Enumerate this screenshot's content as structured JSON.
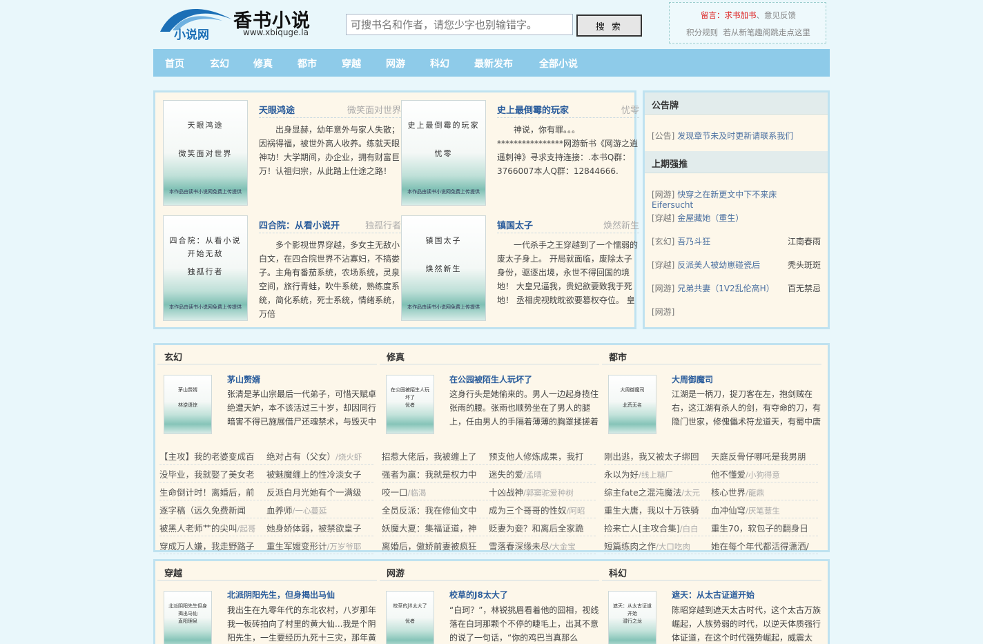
{
  "header": {
    "logo_cn": "小说网",
    "logo_title": "香书小说",
    "logo_url": "www.xbiquge.la",
    "search_placeholder": "可搜书名和作者，请您少字也别输错字。",
    "search_button": "搜 索",
    "notice_prefix": "留言：",
    "notice_link1": "求书加书",
    "notice_sep": "、",
    "notice_link2": "意见反馈",
    "notice_row2a": "积分规则",
    "notice_row2b": "若从新笔趣阁跳走点这里"
  },
  "nav": [
    "首页",
    "玄幻",
    "修真",
    "都市",
    "穿越",
    "网游",
    "科幻",
    "最新发布",
    "全部小说"
  ],
  "featured": [
    {
      "title": "天眼鸿途",
      "author": "微笑面对世界",
      "cover_title": "天眼鸿途",
      "cover_author": "微笑面对世界",
      "desc": "出身显赫，幼年意外与家人失散；因祸得福，被世外高人收养。练就天眼神功！大学期间，办企业，拥有财富巨万！认祖归宗，从此踏上仕途之路！"
    },
    {
      "title": "史上最倒霉的玩家",
      "author": "忧零",
      "cover_title": "史上最倒霉的玩家",
      "cover_author": "忧零",
      "desc": "神说，你有罪。。。****************网游新书《网游之逍遥刺神》寻求支持连接：.本书Q群：3766007本人Q群：12844666."
    },
    {
      "title": "四合院：从看小说开",
      "author": "独孤行者",
      "cover_title": "四合院：从看小说开始无敌",
      "cover_author": "独孤行者",
      "desc": "多个影视世界穿越，多女主无敌小白文，在四合院世界不沾寡妇，不搞娄子。主角有番茄系统，农场系统，灵泉空间，旅行青蛙，吹牛系统，熟练度系统，简化系统，死士系统，情绪系统，万倍"
    },
    {
      "title": "镇国太子",
      "author": "焕然新生",
      "cover_title": "镇国太子",
      "cover_author": "焕然新生",
      "desc": "一代杀手之王穿越到了一个懦弱的废太子身上。 开局就面临，废除太子身份，驱逐出境，永世不得回国的境地！ 大皇兄逼我，贵妃欲要致我于死地！ 丞相虎视眈眈欲要篡权夺位。 皇"
    }
  ],
  "cover_footer": "本作品由读书小说网免费上传提供",
  "sidebar": {
    "board_title": "公告牌",
    "board_items": [
      {
        "cat": "[公告]",
        "text": "发现章节未及时更新请联系我们"
      }
    ],
    "strong_title": "上期强推",
    "strong_items": [
      {
        "cat": "[网游]",
        "title": "快穿之在新更文中下不来床 Eifersucht",
        "author": ""
      },
      {
        "cat": "[穿越]",
        "title": "金屋藏她（重生）",
        "author": ""
      },
      {
        "cat": "[玄幻]",
        "title": "吾乃斗狂",
        "author": "江南春雨"
      },
      {
        "cat": "[穿越]",
        "title": "反派美人被幼崽碰瓷后",
        "author": "秃头斑斑"
      },
      {
        "cat": "[网游]",
        "title": "兄弟共妻（1V2乱伦高H）",
        "author": "百无禁忌"
      },
      {
        "cat": "[网游]",
        "title": "",
        "author": ""
      }
    ]
  },
  "categories_row1": [
    {
      "name": "玄幻",
      "top": {
        "title": "茅山赘婿",
        "cover_title": "茅山赘婿",
        "cover_author": "林逆语惊",
        "desc": "张清是茅山宗最后一代弟子，可惜天赋卓绝遭天妒，本不该活过三十岁，却因同行暗害不得已施展借尸还魂禁术，与毁灭中"
      },
      "list": [
        {
          "t": "【主攻】我的老婆变成百",
          "a": ""
        },
        {
          "t": "绝对占有（父女）",
          "a": "/烧火虾"
        },
        {
          "t": "没毕业，我就娶了美女老",
          "a": ""
        },
        {
          "t": "被魅魔缠上的性冷淡女子",
          "a": ""
        },
        {
          "t": "生命倒计时！离婚后，前",
          "a": ""
        },
        {
          "t": "反派白月光她有个一满级",
          "a": ""
        },
        {
          "t": "逐字稿（远久免费新闻",
          "a": ""
        },
        {
          "t": "血养师",
          "a": "/一心蔓延"
        },
        {
          "t": "被黑人老师艹的尖叫",
          "a": "/起哥"
        },
        {
          "t": "她身娇体弱，被禁欲皇子",
          "a": ""
        },
        {
          "t": "穿成万人嫌，我走野路子",
          "a": ""
        },
        {
          "t": "重生军嫂变形计",
          "a": "/万岁爷耶"
        }
      ]
    },
    {
      "name": "修真",
      "top": {
        "title": "在公园被陌生人玩坏了",
        "cover_title": "在公园被陌生人玩坏了",
        "cover_author": "忧者",
        "desc": "这身行头是她偷来的。男人一边起身揽住张雨的腰。张雨也顺势坐在了男人的腿上，任由男人的手隔着薄薄的胸罩揉搓着"
      },
      "list": [
        {
          "t": "招惹大佬后，我被缠上了",
          "a": ""
        },
        {
          "t": "预支他人修炼成果，我打",
          "a": ""
        },
        {
          "t": "强者为赢：我就是权力中",
          "a": ""
        },
        {
          "t": "迷失的爱",
          "a": "/孟晴"
        },
        {
          "t": "咬一口",
          "a": "/临渴"
        },
        {
          "t": "十凶战神",
          "a": "/郭窦驼爱种树"
        },
        {
          "t": "全员反派：我在修仙文中",
          "a": ""
        },
        {
          "t": "成为三个哥哥的性奴",
          "a": "/阿昭"
        },
        {
          "t": "妖魔大夏：集福证道，神",
          "a": ""
        },
        {
          "t": "贬妻为妾？和离后全家跪",
          "a": ""
        },
        {
          "t": "离婚后，傲娇前妻被疯狂",
          "a": ""
        },
        {
          "t": "雪落春深缘未尽",
          "a": "/大金宝"
        }
      ]
    },
    {
      "name": "都市",
      "top": {
        "title": "大周御魔司",
        "cover_title": "大周御魔司",
        "cover_author": "北荒无名",
        "desc": "江湖是一柄刀，捉刀客在左，抱剑贼在右，这江湖有杀人的剑，有夺命的刀，有隐门世家，修傀儡术符龙道天，有蜀中唐"
      },
      "list": [
        {
          "t": "刚出逃，我又被太子绑回",
          "a": ""
        },
        {
          "t": "天庭反骨仔哪吒是我男朋",
          "a": ""
        },
        {
          "t": "永以为好",
          "a": "/线上糖厂"
        },
        {
          "t": "他不懂爱",
          "a": "/小狗得意"
        },
        {
          "t": "综主fate之混沌魔法",
          "a": "/太元"
        },
        {
          "t": "核心世界",
          "a": "/龍鼎"
        },
        {
          "t": "重生大唐，我以十万铁骑",
          "a": ""
        },
        {
          "t": "血冲仙穹",
          "a": "/厌笔薏生"
        },
        {
          "t": "捡来亡人[主攻合集]",
          "a": "/白白"
        },
        {
          "t": "重生70，软包子的翻身日",
          "a": ""
        },
        {
          "t": "短篇练肉之作",
          "a": "/大口吃肉"
        },
        {
          "t": "她在每个年代都活得潇洒/",
          "a": ""
        }
      ]
    }
  ],
  "categories_row2": [
    {
      "name": "穿越",
      "top": {
        "title": "北派阴阳先生，但身揭出马仙",
        "cover_title": "北派阴阳先生但身揭出马仙",
        "cover_author": "直阳理泉",
        "desc": "我出生在九零年代的东北农村，八岁那年我一板砖拍向了村里的黄大仙...我是个阴阳先生，一生要经历九死十三灾，那年黄"
      }
    },
    {
      "name": "网游",
      "top": {
        "title": "校草的J8太大了",
        "cover_title": "校草的J8太大了",
        "cover_author": "忧者",
        "desc": "“白珂？”，林锐挑眉看着他的囧相，视线落在白珂那颗个不停的睫毛上，出其不意的说了一句话，“你的鸡巴当真那么"
      }
    },
    {
      "name": "科幻",
      "top": {
        "title": "遮天：从太古证道开始",
        "cover_title": "遮天：从太古证道开始",
        "cover_author": "潜行之龙",
        "desc": "陈昭穿越到遮天太古时代，这个太古万族崛起，人族势弱的时代，以逆天体质强行体证道，在这个时代强势崛起，威震太"
      }
    }
  ]
}
